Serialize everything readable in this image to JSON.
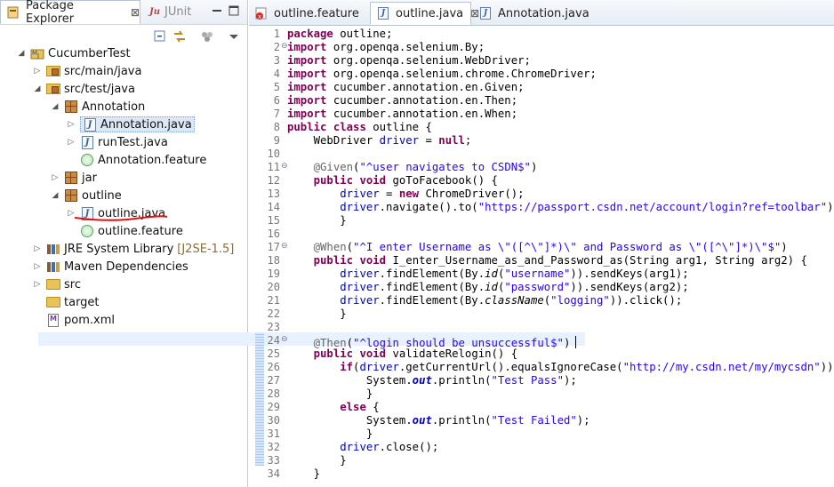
{
  "left_panel": {
    "tabs": [
      {
        "label": "Package Explorer",
        "close": "⊠"
      },
      {
        "label": "JUnit"
      }
    ],
    "tree": [
      {
        "label": "CucumberTest",
        "icon": "project-icon",
        "twisty": "down"
      },
      {
        "label": "src/main/java",
        "icon": "source-folder-icon",
        "twisty": "right"
      },
      {
        "label": "src/test/java",
        "icon": "source-folder-icon",
        "twisty": "down"
      },
      {
        "label": "Annotation",
        "icon": "package-icon",
        "twisty": "down"
      },
      {
        "label": "Annotation.java",
        "icon": "java-file-icon",
        "twisty": "right"
      },
      {
        "label": "runTest.java",
        "icon": "java-file-icon",
        "twisty": "right"
      },
      {
        "label": "Annotation.feature",
        "icon": "feature-file-icon",
        "twisty": ""
      },
      {
        "label": "jar",
        "icon": "package-icon",
        "twisty": "right"
      },
      {
        "label": "outline",
        "icon": "package-icon",
        "twisty": "down"
      },
      {
        "label": "outline.java",
        "icon": "java-file-icon",
        "twisty": "right"
      },
      {
        "label": "outline.feature",
        "icon": "feature-file-icon",
        "twisty": ""
      },
      {
        "label": "JRE System Library",
        "decoration": "[J2SE-1.5]",
        "icon": "library-icon",
        "twisty": "right"
      },
      {
        "label": "Maven Dependencies",
        "icon": "library-icon",
        "twisty": "right"
      },
      {
        "label": "src",
        "icon": "folder-icon",
        "twisty": "right"
      },
      {
        "label": "target",
        "icon": "folder-icon",
        "twisty": ""
      },
      {
        "label": "pom.xml",
        "icon": "pom-icon",
        "twisty": ""
      }
    ]
  },
  "editor": {
    "tabs": [
      {
        "label": "outline.feature",
        "active": false
      },
      {
        "label": "outline.java",
        "active": true,
        "close": "⊠"
      },
      {
        "label": "Annotation.java",
        "active": false
      }
    ],
    "lines": [
      [
        [
          "kw",
          "package"
        ],
        [
          "t",
          " outline;"
        ]
      ],
      [
        [
          "kw",
          "import"
        ],
        [
          "t",
          " org.openqa.selenium.By;"
        ]
      ],
      [
        [
          "kw",
          "import"
        ],
        [
          "t",
          " org.openqa.selenium.WebDriver;"
        ]
      ],
      [
        [
          "kw",
          "import"
        ],
        [
          "t",
          " org.openqa.selenium.chrome.ChromeDriver;"
        ]
      ],
      [
        [
          "kw",
          "import"
        ],
        [
          "t",
          " cucumber.annotation.en.Given;"
        ]
      ],
      [
        [
          "kw",
          "import"
        ],
        [
          "t",
          " cucumber.annotation.en.Then;"
        ]
      ],
      [
        [
          "kw",
          "import"
        ],
        [
          "t",
          " cucumber.annotation.en.When;"
        ]
      ],
      [
        [
          "kw",
          "public"
        ],
        [
          "t",
          " "
        ],
        [
          "kw",
          "class"
        ],
        [
          "t",
          " outline {"
        ]
      ],
      [
        [
          "t",
          "    WebDriver "
        ],
        [
          "fld",
          "driver"
        ],
        [
          "t",
          " = "
        ],
        [
          "kw",
          "null"
        ],
        [
          "t",
          ";"
        ]
      ],
      [
        [
          "t",
          ""
        ]
      ],
      [
        [
          "ann",
          "    @Given"
        ],
        [
          "t",
          "("
        ],
        [
          "str",
          "\"^user navigates to CSDN$\""
        ],
        [
          "t",
          ")"
        ]
      ],
      [
        [
          "t",
          "    "
        ],
        [
          "kw",
          "public"
        ],
        [
          "t",
          " "
        ],
        [
          "kw",
          "void"
        ],
        [
          "t",
          " goToFacebook() {"
        ]
      ],
      [
        [
          "t",
          "        "
        ],
        [
          "fld",
          "driver"
        ],
        [
          "t",
          " = "
        ],
        [
          "kw",
          "new"
        ],
        [
          "t",
          " ChromeDriver();"
        ]
      ],
      [
        [
          "t",
          "        "
        ],
        [
          "fld",
          "driver"
        ],
        [
          "t",
          ".navigate().to("
        ],
        [
          "str",
          "\"https://passport.csdn.net/account/login?ref=toolbar\""
        ],
        [
          "t",
          ");"
        ]
      ],
      [
        [
          "t",
          "        }"
        ]
      ],
      [
        [
          "t",
          ""
        ]
      ],
      [
        [
          "ann",
          "    @When"
        ],
        [
          "t",
          "("
        ],
        [
          "str",
          "\"^I enter Username as \\\"([^\\\"]*)\\\" and Password as \\\"([^\\\"]*)\\\"$\""
        ],
        [
          "t",
          ")"
        ]
      ],
      [
        [
          "t",
          "    "
        ],
        [
          "kw",
          "public"
        ],
        [
          "t",
          " "
        ],
        [
          "kw",
          "void"
        ],
        [
          "t",
          " I_enter_Username_as_and_Password_as(String arg1, String arg2) {"
        ]
      ],
      [
        [
          "t",
          "        "
        ],
        [
          "fld",
          "driver"
        ],
        [
          "t",
          ".findElement(By."
        ],
        [
          "it",
          "id"
        ],
        [
          "t",
          "("
        ],
        [
          "str",
          "\"username\""
        ],
        [
          "t",
          ")).sendKeys(arg1);"
        ]
      ],
      [
        [
          "t",
          "        "
        ],
        [
          "fld",
          "driver"
        ],
        [
          "t",
          ".findElement(By."
        ],
        [
          "it",
          "id"
        ],
        [
          "t",
          "("
        ],
        [
          "str",
          "\"password\""
        ],
        [
          "t",
          ")).sendKeys(arg2);"
        ]
      ],
      [
        [
          "t",
          "        "
        ],
        [
          "fld",
          "driver"
        ],
        [
          "t",
          ".findElement(By."
        ],
        [
          "it",
          "className"
        ],
        [
          "t",
          "("
        ],
        [
          "str",
          "\"logging\""
        ],
        [
          "t",
          ")).click();"
        ]
      ],
      [
        [
          "t",
          "        }"
        ]
      ],
      [
        [
          "t",
          ""
        ]
      ],
      [
        [
          "ann",
          "    @Then"
        ],
        [
          "t",
          "("
        ],
        [
          "str",
          "\"^login should be unsuccessful$\""
        ],
        [
          "t",
          ")"
        ]
      ],
      [
        [
          "t",
          "    "
        ],
        [
          "kw",
          "public"
        ],
        [
          "t",
          " "
        ],
        [
          "kw",
          "void"
        ],
        [
          "t",
          " validateRelogin() {"
        ]
      ],
      [
        [
          "t",
          "        "
        ],
        [
          "kw",
          "if"
        ],
        [
          "t",
          "("
        ],
        [
          "fld",
          "driver"
        ],
        [
          "t",
          ".getCurrentUrl().equalsIgnoreCase("
        ],
        [
          "str",
          "\"http://my.csdn.net/my/mycsdn\""
        ],
        [
          "t",
          "))"
        ],
        [
          "t",
          "{"
        ]
      ],
      [
        [
          "t",
          "            System."
        ],
        [
          "sfld",
          "out"
        ],
        [
          "t",
          ".println("
        ],
        [
          "str",
          "\"Test Pass\""
        ],
        [
          "t",
          ");"
        ]
      ],
      [
        [
          "t",
          "            }"
        ]
      ],
      [
        [
          "t",
          "        "
        ],
        [
          "kw",
          "else"
        ],
        [
          "t",
          " {"
        ]
      ],
      [
        [
          "t",
          "            System."
        ],
        [
          "sfld",
          "out"
        ],
        [
          "t",
          ".println("
        ],
        [
          "str",
          "\"Test Failed\""
        ],
        [
          "t",
          ");"
        ]
      ],
      [
        [
          "t",
          "            }"
        ]
      ],
      [
        [
          "t",
          "        "
        ],
        [
          "fld",
          "driver"
        ],
        [
          "t",
          ".close();"
        ]
      ],
      [
        [
          "t",
          "        }"
        ]
      ],
      [
        [
          "t",
          "    }"
        ]
      ]
    ],
    "folded_markers": [
      2,
      11,
      17,
      24
    ],
    "current_line": 24
  }
}
